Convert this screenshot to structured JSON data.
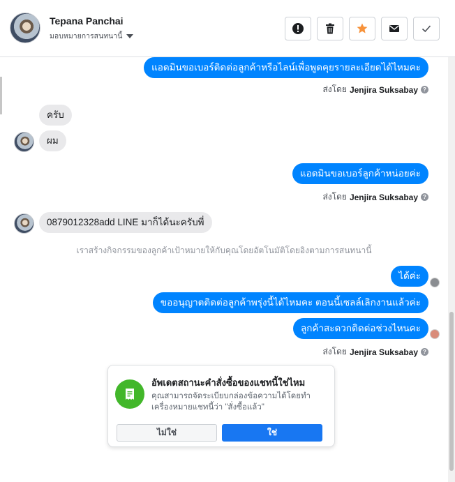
{
  "header": {
    "name": "Tepana Panchai",
    "assign_label": "มอบหมายการสนทนานี้"
  },
  "actions": {
    "icons": [
      "alert-icon",
      "trash-icon",
      "star-icon",
      "mail-icon",
      "check-icon"
    ],
    "star_color": "#f7923a"
  },
  "messages": {
    "out_1": "แอดมินขอเบอร์ติดต่อลูกค้าหรือไลน์เพื่อพูดคุยรายละเอียดได้ไหมคะ",
    "sent_prefix": "ส่งโดย",
    "sent_name": "Jenjira Suksabay",
    "in_1": "ครับ",
    "in_2": "ผม",
    "out_2": "แอดมินขอเบอร์ลูกค้าหน่อยค่ะ",
    "in_3": "0879012328add LINE มาก็ได้นะครับพี่",
    "system": "เราสร้างกิจกรรมของลูกค้าเป้าหมายให้กับคุณโดยอัตโนมัติโดยอิงตามการสนทนานี้",
    "out_3": "ได้ค่ะ",
    "out_4": "ขออนุญาตติดต่อลูกค้าพรุ่งนี้ได้ไหมคะ ตอนนี้เซลล์เลิกงานแล้วค่ะ",
    "out_5": "ลูกค้าสะดวกติดต่อช่วงไหนคะ"
  },
  "card": {
    "title": "อัพเดตสถานะคำสั่งซื้อของแชทนี้ใช่ไหม",
    "description": "คุณสามารถจัดระเบียบกล่องข้อความได้โดยทำเครื่องหมายแชทนี้ว่า \"สั่งซื้อแล้ว\"",
    "no_label": "ไม่ใช่",
    "yes_label": "ใช่"
  },
  "colors": {
    "accent": "#0084ff",
    "primary_button": "#1877f2",
    "card_icon": "#42b72a"
  }
}
